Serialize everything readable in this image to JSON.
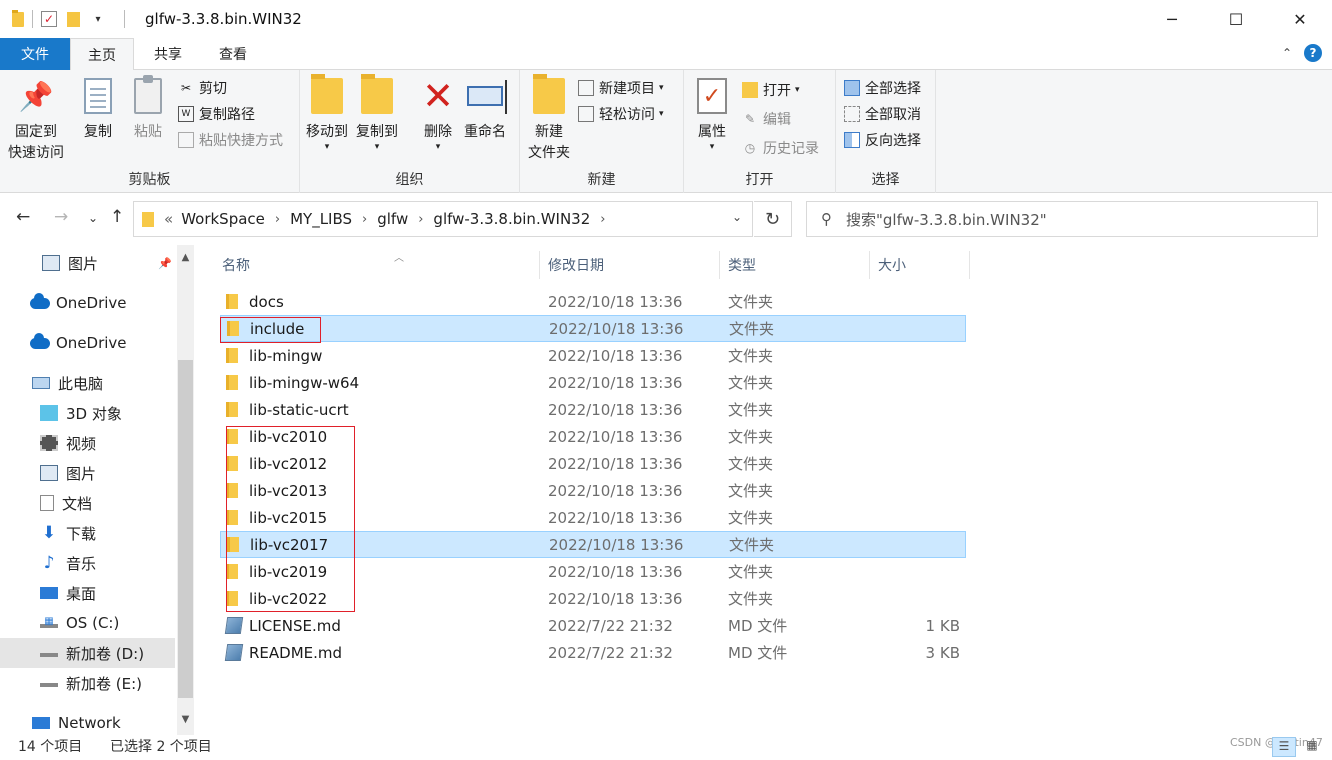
{
  "window": {
    "title": "glfw-3.3.8.bin.WIN32",
    "minimize": "─",
    "maximize": "☐",
    "close": "✕"
  },
  "tabs": {
    "file": "文件",
    "home": "主页",
    "share": "共享",
    "view": "查看"
  },
  "ribbon": {
    "clipboard": {
      "label": "剪贴板",
      "pin_line1": "固定到",
      "pin_line2": "快速访问",
      "copy": "复制",
      "paste": "粘贴",
      "cut": "剪切",
      "copy_path": "复制路径",
      "paste_shortcut": "粘贴快捷方式"
    },
    "organize": {
      "label": "组织",
      "move_to": "移动到",
      "copy_to": "复制到",
      "delete": "删除",
      "rename": "重命名"
    },
    "new": {
      "label": "新建",
      "new_folder_line1": "新建",
      "new_folder_line2": "文件夹",
      "new_item": "新建项目",
      "easy_access": "轻松访问"
    },
    "open": {
      "label": "打开",
      "properties": "属性",
      "open": "打开",
      "edit": "编辑",
      "history": "历史记录"
    },
    "select": {
      "label": "选择",
      "select_all": "全部选择",
      "select_none": "全部取消",
      "invert": "反向选择"
    }
  },
  "address": {
    "overflow": "«",
    "crumbs": [
      "WorkSpace",
      "MY_LIBS",
      "glfw",
      "glfw-3.3.8.bin.WIN32"
    ],
    "search_placeholder": "搜索\"glfw-3.3.8.bin.WIN32\""
  },
  "sidebar": {
    "items": [
      {
        "label": "图片",
        "icon": "pictures-icon"
      },
      {
        "label": "OneDrive",
        "icon": "onedrive-icon"
      },
      {
        "label": "OneDrive",
        "icon": "onedrive-icon"
      },
      {
        "label": "此电脑",
        "icon": "this-pc-icon"
      },
      {
        "label": "3D 对象",
        "icon": "3d-objects-icon"
      },
      {
        "label": "视频",
        "icon": "videos-icon"
      },
      {
        "label": "图片",
        "icon": "pictures-icon"
      },
      {
        "label": "文档",
        "icon": "documents-icon"
      },
      {
        "label": "下载",
        "icon": "downloads-icon"
      },
      {
        "label": "音乐",
        "icon": "music-icon"
      },
      {
        "label": "桌面",
        "icon": "desktop-icon"
      },
      {
        "label": "OS (C:)",
        "icon": "drive-c-icon"
      },
      {
        "label": "新加卷 (D:)",
        "icon": "drive-d-icon"
      },
      {
        "label": "新加卷 (E:)",
        "icon": "drive-e-icon"
      },
      {
        "label": "Network",
        "icon": "network-icon"
      }
    ]
  },
  "columns": {
    "name": "名称",
    "date": "修改日期",
    "type": "类型",
    "size": "大小"
  },
  "files": [
    {
      "name": "docs",
      "date": "2022/10/18 13:36",
      "type": "文件夹",
      "size": "",
      "kind": "folder"
    },
    {
      "name": "include",
      "date": "2022/10/18 13:36",
      "type": "文件夹",
      "size": "",
      "kind": "folder",
      "selected": true
    },
    {
      "name": "lib-mingw",
      "date": "2022/10/18 13:36",
      "type": "文件夹",
      "size": "",
      "kind": "folder"
    },
    {
      "name": "lib-mingw-w64",
      "date": "2022/10/18 13:36",
      "type": "文件夹",
      "size": "",
      "kind": "folder"
    },
    {
      "name": "lib-static-ucrt",
      "date": "2022/10/18 13:36",
      "type": "文件夹",
      "size": "",
      "kind": "folder"
    },
    {
      "name": "lib-vc2010",
      "date": "2022/10/18 13:36",
      "type": "文件夹",
      "size": "",
      "kind": "folder"
    },
    {
      "name": "lib-vc2012",
      "date": "2022/10/18 13:36",
      "type": "文件夹",
      "size": "",
      "kind": "folder"
    },
    {
      "name": "lib-vc2013",
      "date": "2022/10/18 13:36",
      "type": "文件夹",
      "size": "",
      "kind": "folder"
    },
    {
      "name": "lib-vc2015",
      "date": "2022/10/18 13:36",
      "type": "文件夹",
      "size": "",
      "kind": "folder"
    },
    {
      "name": "lib-vc2017",
      "date": "2022/10/18 13:36",
      "type": "文件夹",
      "size": "",
      "kind": "folder",
      "selected": true
    },
    {
      "name": "lib-vc2019",
      "date": "2022/10/18 13:36",
      "type": "文件夹",
      "size": "",
      "kind": "folder"
    },
    {
      "name": "lib-vc2022",
      "date": "2022/10/18 13:36",
      "type": "文件夹",
      "size": "",
      "kind": "folder"
    },
    {
      "name": "LICENSE.md",
      "date": "2022/7/22 21:32",
      "type": "MD 文件",
      "size": "1 KB",
      "kind": "md"
    },
    {
      "name": "README.md",
      "date": "2022/7/22 21:32",
      "type": "MD 文件",
      "size": "3 KB",
      "kind": "md"
    }
  ],
  "status": {
    "count": "14 个项目",
    "selected": "已选择 2 个项目"
  },
  "watermark": "CSDN @Bettin47",
  "colors": {
    "accent": "#1979ca",
    "selection": "#cce8ff",
    "highlight_box": "#e0202a"
  }
}
